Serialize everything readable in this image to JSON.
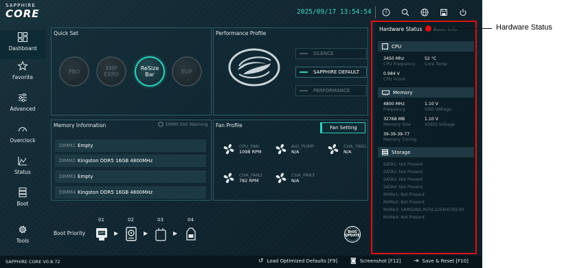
{
  "header": {
    "brand_line1": "SAPPHIRE",
    "brand_line2": "CORE",
    "datetime": "2025/09/17 13:54:54",
    "icons": [
      "help-icon",
      "search-icon",
      "language-icon",
      "save-icon",
      "power-icon"
    ]
  },
  "sidebar": {
    "items": [
      {
        "label": "Dashboard",
        "icon": "dashboard-icon",
        "active": true
      },
      {
        "label": "Favorite",
        "icon": "star-icon"
      },
      {
        "label": "Advanced",
        "icon": "sliders-icon"
      },
      {
        "label": "Overclock",
        "icon": "gauge-icon"
      },
      {
        "label": "Status",
        "icon": "chart-icon"
      },
      {
        "label": "Boot",
        "icon": "server-icon"
      },
      {
        "label": "Tools",
        "icon": "gear-icon"
      }
    ]
  },
  "quick_set": {
    "title": "Quick Set",
    "buttons": [
      {
        "label_1": "PBO",
        "label_2": "",
        "active": false
      },
      {
        "label_1": "XMP",
        "label_2": "EXPO",
        "active": false
      },
      {
        "label_1": "ReSize",
        "label_2": "Bar",
        "active": true
      },
      {
        "label_1": "EUP",
        "label_2": "",
        "active": false
      }
    ]
  },
  "performance": {
    "title": "Performance Profile",
    "options": [
      {
        "label": "SILENCE",
        "active": false
      },
      {
        "label": "SAPPHIRE DEFAULT",
        "active": true
      },
      {
        "label": "PERFORMANCE",
        "active": false
      }
    ]
  },
  "memory": {
    "title": "Memory Information",
    "warning": "DIMM Slot Warning",
    "slots": [
      {
        "slot": "DIMM1",
        "value": "Empty"
      },
      {
        "slot": "DIMM2",
        "value": "Kingston DDR5 16GB 4800MHz"
      },
      {
        "slot": "DIMM3",
        "value": "Empty"
      },
      {
        "slot": "DIMM4",
        "value": "Kingston DDR5 16GB 4800MHz"
      }
    ]
  },
  "fan": {
    "title": "Fan Profile",
    "setting_button": "Fan Setting",
    "fans": [
      {
        "name": "CPU_FAN",
        "value": "1098 RPM"
      },
      {
        "name": "AIO_PUMP",
        "value": "N/A"
      },
      {
        "name": "CHA_FAN1",
        "value": "N/A"
      },
      {
        "name": "CHA_FAN2",
        "value": "782 RPM"
      },
      {
        "name": "CHA_FAN3",
        "value": "N/A"
      }
    ]
  },
  "boot": {
    "label": "Boot Priority",
    "slots": [
      "01",
      "02",
      "03",
      "04"
    ],
    "devices": [
      "uefi-usb-icon",
      "hard-disk-icon",
      "empty-device-icon",
      "network-icon"
    ],
    "bios_update_line1": "BIOS",
    "bios_update_line2": "UPDATE"
  },
  "hardware_status": {
    "tab_active": "Hardware Status",
    "tab_inactive": "Basic Info",
    "cpu": {
      "title": "CPU",
      "frequency_value": "3450 Mhz",
      "frequency_label": "CPU Frequency",
      "temp_value": "52 °C",
      "temp_label": "Core Temp",
      "vcore_value": "0.984 V",
      "vcore_label": "CPU Vcore"
    },
    "memory": {
      "title": "Memory",
      "frequency_value": "4800 MHz",
      "frequency_label": "Frequency",
      "vdd_value": "1.10 V",
      "vdd_label": "VDD Voltage",
      "size_value": "32768 MB",
      "size_label": "Memory Size",
      "vddq_value": "1.10 V",
      "vddq_label": "VDDQ Voltage",
      "timing_value": "39-39-39-77",
      "timing_label": "Memory Timing"
    },
    "storage": {
      "title": "Storage",
      "items": [
        "SATA1: Not Present",
        "SATA2: Not Present",
        "SATA3: Not Present",
        "SATA4: Not Present",
        "NVMe1: Not Present",
        "NVMe2: Not Present",
        "NVMe3: SAMSUNG MZVL2256HCHQ-00",
        "NVMe4: Not Present"
      ]
    }
  },
  "footer": {
    "version": "SAPPHIRE CORE V0.8.72",
    "load_defaults": "Load Optimized Defaults [F9]",
    "screenshot": "Screenshot [F12]",
    "save_reset": "Save & Reset [F10]"
  },
  "annotation": {
    "label": "Hardware Status"
  },
  "colors": {
    "accent": "#2ed1bd",
    "annotation_red": "#e01010",
    "background": "#102630"
  }
}
